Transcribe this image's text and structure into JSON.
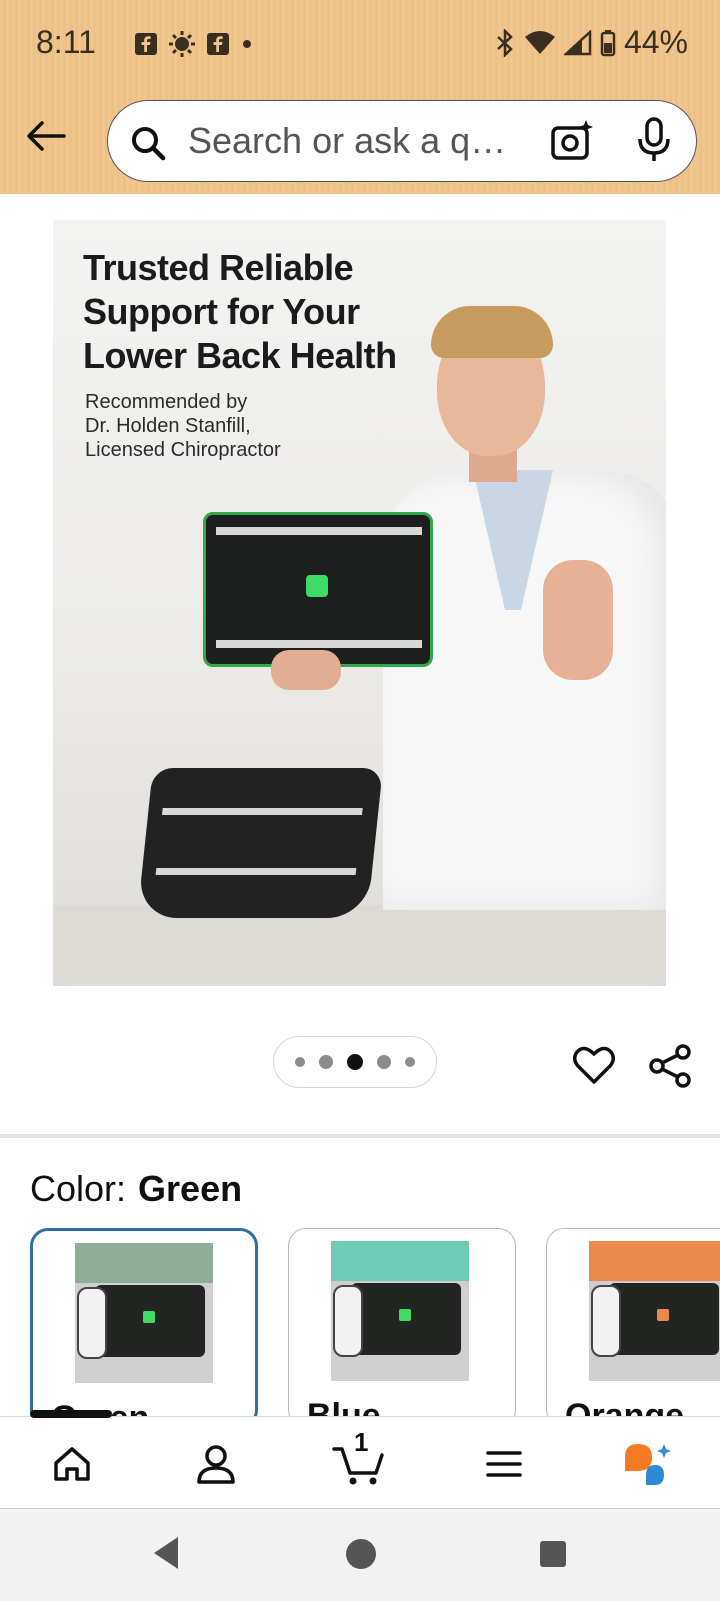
{
  "status_bar": {
    "time": "8:11",
    "battery": "44%"
  },
  "search": {
    "placeholder": "Search or ask a q…"
  },
  "product_image": {
    "headline_lines": [
      "Trusted Reliable",
      "Support for Your",
      "Lower Back Health"
    ],
    "sub_lines": [
      "Recommended by",
      "Dr. Holden Stanfill,",
      "Licensed Chiropractor"
    ],
    "gallery_count": 5,
    "gallery_active": 3
  },
  "color_section": {
    "label": "Color:",
    "selected": "Green",
    "options": [
      {
        "name": "Green",
        "shirt": "#8fae98",
        "accent": "#3fdc65"
      },
      {
        "name": "Blue",
        "shirt": "#6ecbb8",
        "accent": "#3fdc65"
      },
      {
        "name": "Orange",
        "shirt": "#e98a4c",
        "accent": "#e98a4c"
      }
    ]
  },
  "bottom_nav": {
    "cart_count": "1",
    "items": [
      "home-icon",
      "account-icon",
      "cart-icon",
      "menu-icon",
      "rufus-icon"
    ]
  },
  "colors": {
    "header": "#f0c68f",
    "selected_border": "#2f6fa8",
    "rufus_orange": "#f57a23",
    "rufus_blue": "#2f8ad4"
  }
}
